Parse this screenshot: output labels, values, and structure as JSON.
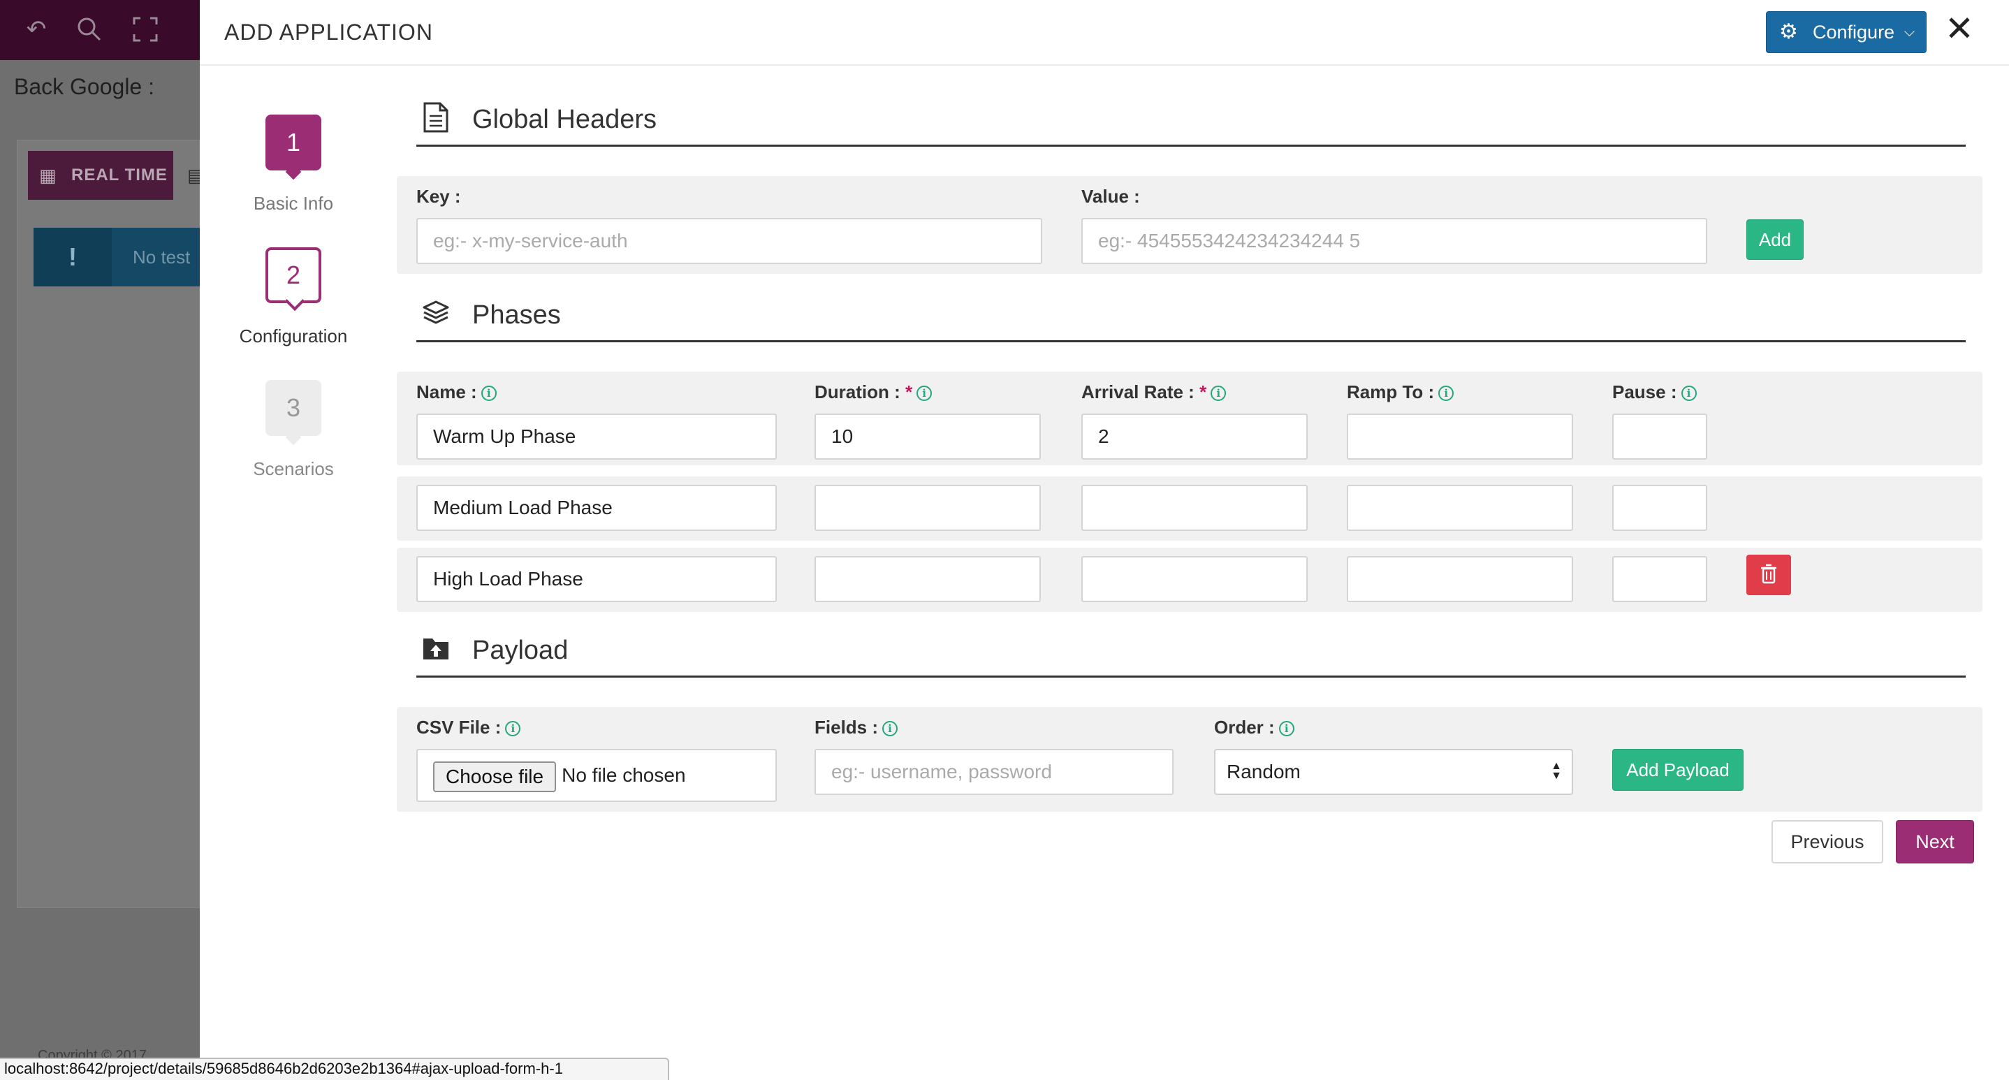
{
  "background": {
    "topbar_icons": [
      "back-arrow-icon",
      "search-icon",
      "fullscreen-icon"
    ],
    "page_title": "Back Google :",
    "tab_label": "REAL TIME",
    "alert_text": "No test",
    "footer_text": "Copyright © 2017"
  },
  "modal": {
    "title": "ADD APPLICATION",
    "configure_label": "Configure"
  },
  "steps": [
    {
      "number": "1",
      "label": "Basic Info",
      "state": "completed"
    },
    {
      "number": "2",
      "label": "Configuration",
      "state": "active"
    },
    {
      "number": "3",
      "label": "Scenarios",
      "state": "pending"
    }
  ],
  "global_headers": {
    "title": "Global Headers",
    "key_label": "Key :",
    "key_placeholder": "eg:- x-my-service-auth",
    "value_label": "Value :",
    "value_placeholder": "eg:- 4545553424234234244 5",
    "add_label": "Add"
  },
  "phases": {
    "title": "Phases",
    "headers": {
      "name": "Name :",
      "duration": "Duration :",
      "arrival_rate": "Arrival Rate :",
      "ramp_to": "Ramp To :",
      "pause": "Pause :",
      "required_mark": "*"
    },
    "rows": [
      {
        "name": "Warm Up Phase",
        "duration": "10",
        "arrival_rate": "2",
        "ramp_to": "",
        "pause": ""
      },
      {
        "name": "Medium Load Phase",
        "duration": "",
        "arrival_rate": "",
        "ramp_to": "",
        "pause": ""
      },
      {
        "name": "High Load Phase",
        "duration": "",
        "arrival_rate": "",
        "ramp_to": "",
        "pause": ""
      }
    ]
  },
  "payload": {
    "title": "Payload",
    "csv_label": "CSV File :",
    "choose_file_label": "Choose file",
    "no_file_text": "No file chosen",
    "fields_label": "Fields :",
    "fields_placeholder": "eg:- username, password",
    "order_label": "Order :",
    "order_selected": "Random",
    "add_payload_label": "Add Payload"
  },
  "nav": {
    "previous_label": "Previous",
    "next_label": "Next"
  },
  "status_bar": {
    "url": "localhost:8642/project/details/59685d8646b2d6203e2b1364#ajax-upload-form-h-1"
  },
  "colors": {
    "brand": "#9b2d74",
    "configure_blue": "#1a6aa3",
    "success_green": "#2ab785",
    "danger_red": "#e03c4a"
  }
}
